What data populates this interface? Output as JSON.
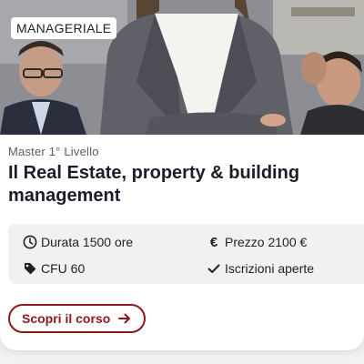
{
  "card": {
    "badge": "MANAGERIALE",
    "subtitle": "Master 1° Livello",
    "title": "Il Real Estate, property & building management",
    "info": {
      "duration": "Durata 1500 ore",
      "price": "Prezzo 2100 €",
      "cfu": "CFU 60",
      "enrollment": "Iscrizioni aperte"
    },
    "cta_label": "Scopri il corso"
  },
  "icons": {
    "duration": "clock-icon",
    "price": "euro-icon",
    "cfu": "tag-icon",
    "enrollment": "check-icon",
    "cta": "arrow-right-icon"
  },
  "colors": {
    "accent": "#8b1a1a",
    "title": "#1c1c2b",
    "info_background": "#f1f1f3"
  }
}
